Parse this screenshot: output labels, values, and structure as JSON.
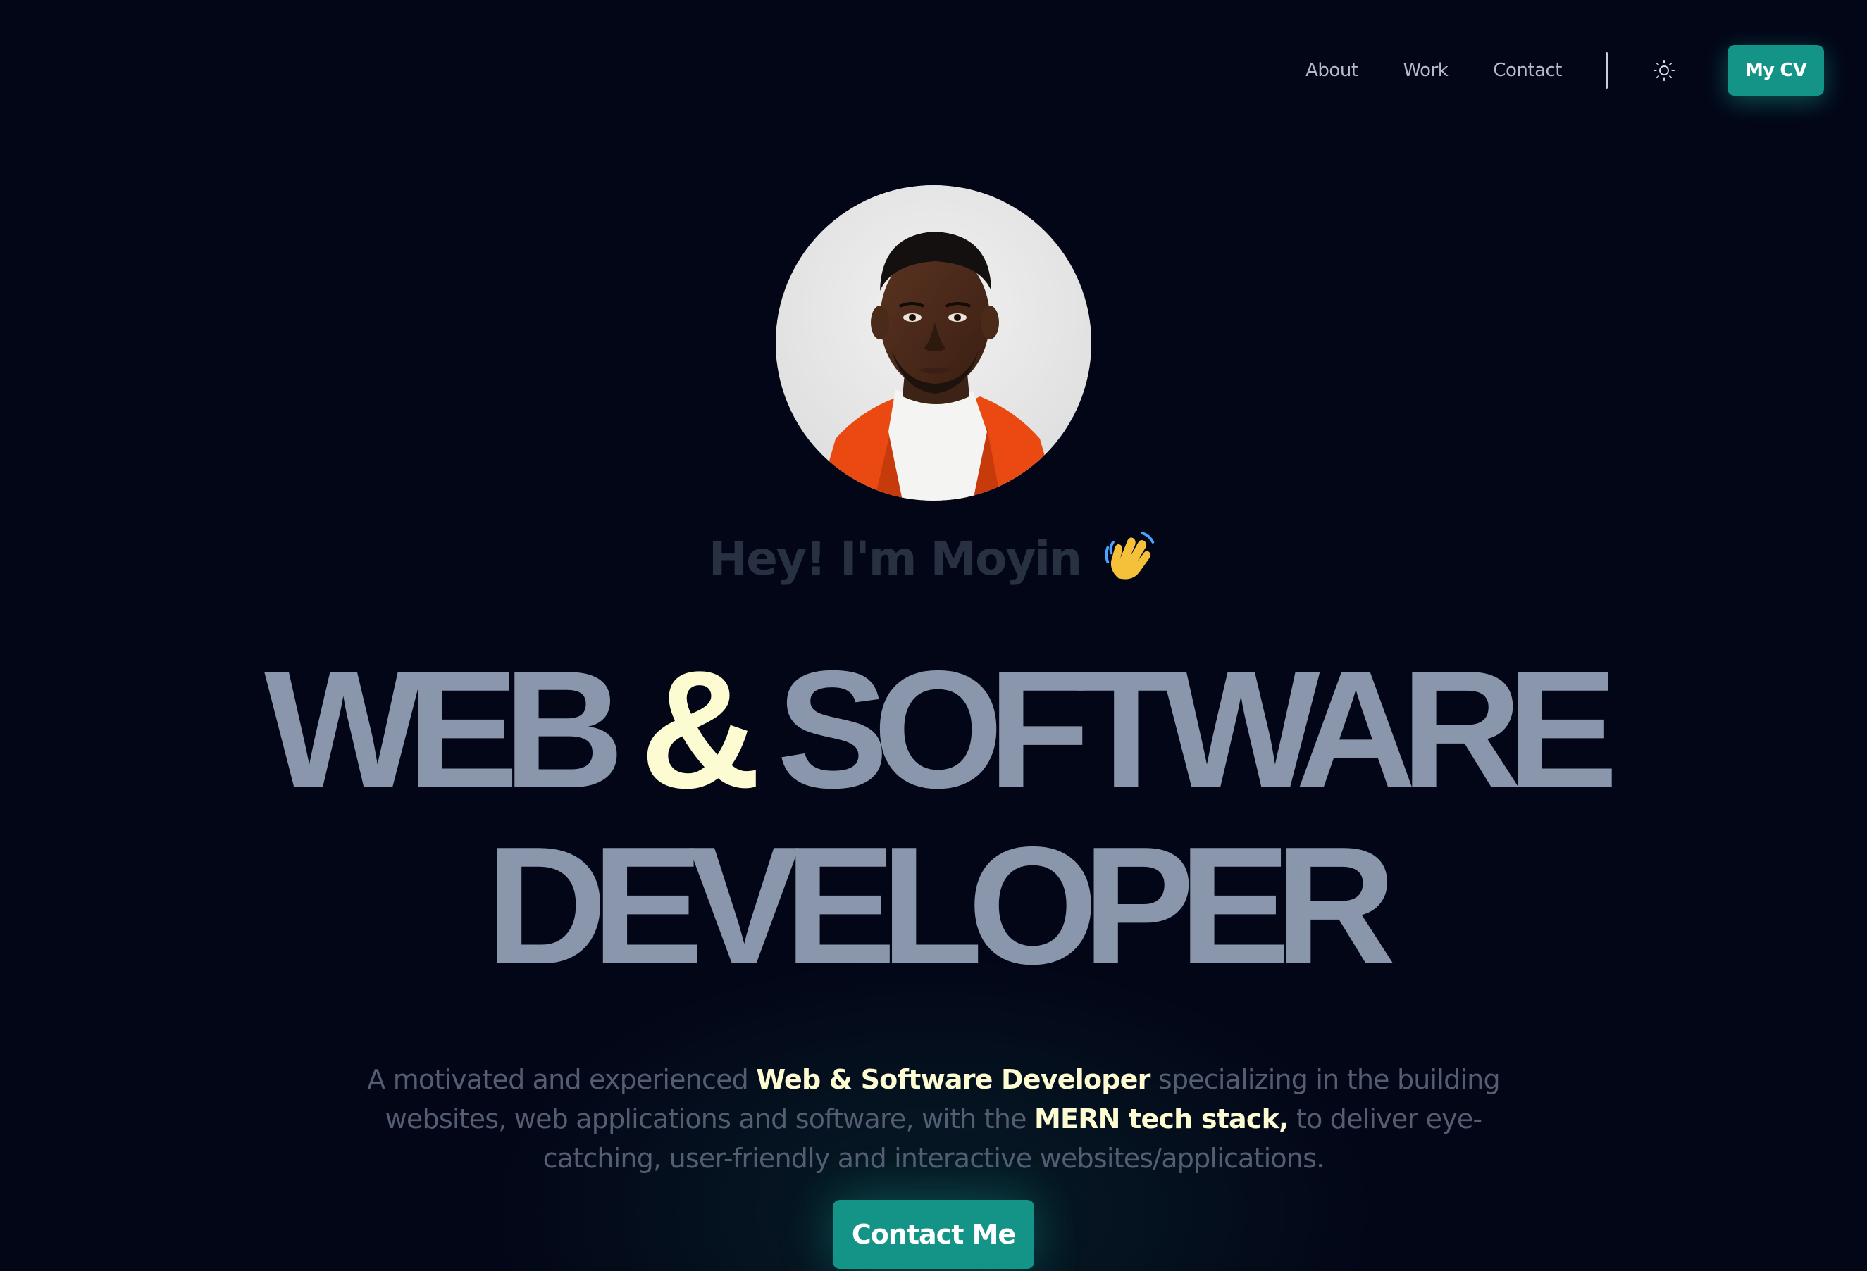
{
  "nav": {
    "links": [
      {
        "label": "About"
      },
      {
        "label": "Work"
      },
      {
        "label": "Contact"
      }
    ],
    "theme_toggle_icon": "sun-icon",
    "cv_button_label": "My CV"
  },
  "hero": {
    "avatar_icon": "profile-photo",
    "greeting": "Hey! I'm Moyin",
    "greeting_icon": "waving-hand-icon",
    "headline": {
      "line1_part1": "WEB",
      "line1_amp": "&",
      "line1_part2": "SOFTWARE",
      "line2": "DEVELOPER"
    },
    "description": {
      "part1": "A motivated and experienced ",
      "highlight1": "Web & Software Developer",
      "part2": " specializing in the building websites, web applications and software, with the ",
      "highlight2": "MERN tech stack,",
      "part3": " to deliver eye-catching, user-friendly and interactive websites/applications."
    },
    "cta_label": "Contact Me"
  },
  "colors": {
    "background": "#030617",
    "accent": "#139486",
    "headline": "#8996ac",
    "highlight": "#fdfbd1",
    "muted_text": "#545d72"
  }
}
